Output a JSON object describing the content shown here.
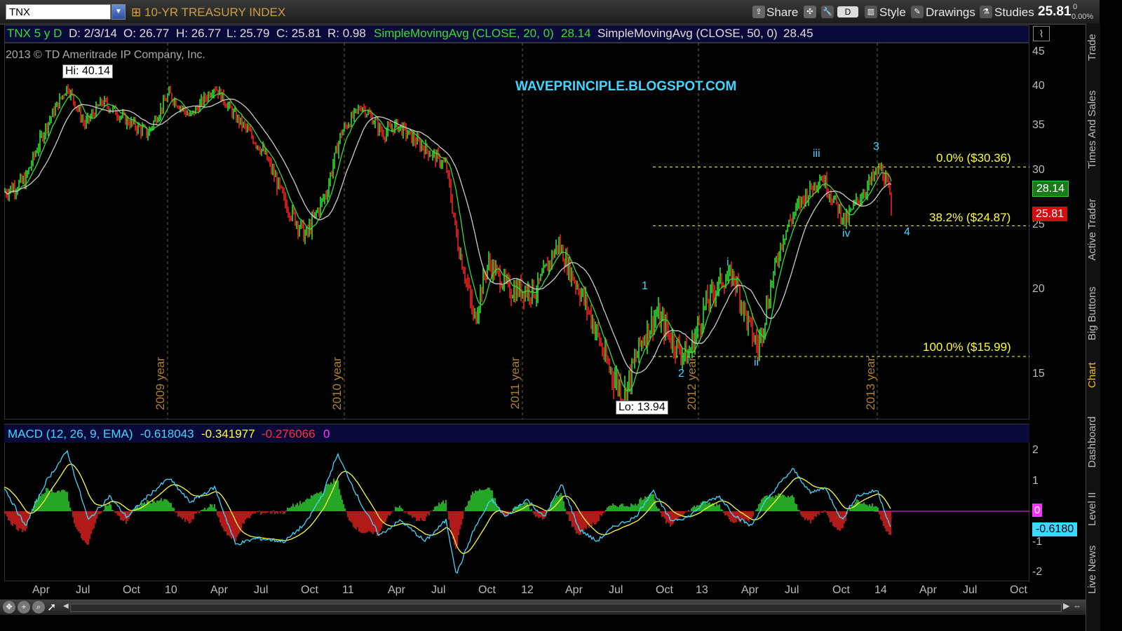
{
  "toolbar": {
    "symbol": "TNX",
    "title": "10-YR TREASURY INDEX",
    "share_label": "Share",
    "period_label": "D",
    "style_label": "Style",
    "drawings_label": "Drawings",
    "studies_label": "Studies",
    "last_price": "25.81",
    "change_top": "0",
    "change_bottom": "0.00%"
  },
  "info": {
    "symbol_period": "TNX 5 y D",
    "date": "D: 2/3/14",
    "open": "O: 26.77",
    "high": "H: 26.77",
    "low": "L: 25.79",
    "close": "C: 25.81",
    "range": "R: 0.98",
    "sma20_label": "SimpleMovingAvg (CLOSE, 20, 0)",
    "sma20_value": "28.14",
    "sma50_label": "SimpleMovingAvg (CLOSE, 50, 0)",
    "sma50_value": "28.45"
  },
  "chart": {
    "copyright": "2013 © TD Ameritrade IP Company, Inc.",
    "watermark": "WAVEPRINCIPLE.BLOGSPOT.COM",
    "hi_label": "Hi: 40.14",
    "lo_label": "Lo: 13.94",
    "sma_badge": "28.14",
    "price_badge": "25.81",
    "y_ticks": [
      "45",
      "40",
      "35",
      "30",
      "25",
      "20",
      "15"
    ],
    "year_markers": [
      "2009 year",
      "2010 year",
      "2011 year",
      "2012 year",
      "2013 year"
    ],
    "fib": {
      "level_0": "0.0%  ($30.36)",
      "level_382": "38.2%  ($24.87)",
      "level_100": "100.0%  ($15.99)"
    },
    "waves": {
      "w1": "1",
      "w2": "2",
      "w3": "3",
      "w4": "4",
      "wi": "i",
      "wii": "ii",
      "wiii": "iii",
      "wiv": "iv"
    },
    "colors": {
      "price_up": "#33dd33",
      "price_down": "#ee2222",
      "sma20": "#33dd33",
      "sma50": "#cccccc",
      "fib": "#ffff33",
      "wave": "#3fd6ff"
    }
  },
  "macd": {
    "label": "MACD (12, 26, 9, EMA)",
    "value": "-0.618043",
    "avg": "-0.341977",
    "diff": "-0.276066",
    "zero": "0",
    "zero_badge": "0",
    "value_badge": "-0.6180",
    "y_ticks": [
      "2",
      "1",
      "-1",
      "-2"
    ]
  },
  "x_axis": [
    "Apr",
    "Jul",
    "Oct",
    "10",
    "Apr",
    "Jul",
    "Oct",
    "11",
    "Apr",
    "Jul",
    "Oct",
    "12",
    "Apr",
    "Jul",
    "Oct",
    "13",
    "Apr",
    "Jul",
    "Oct",
    "14",
    "Apr",
    "Jul",
    "Oct"
  ],
  "side_tabs": [
    "Trade",
    "Times And Sales",
    "Active Trader",
    "Big Buttons",
    "Chart",
    "Dashboard",
    "Level II",
    "Live News"
  ]
}
